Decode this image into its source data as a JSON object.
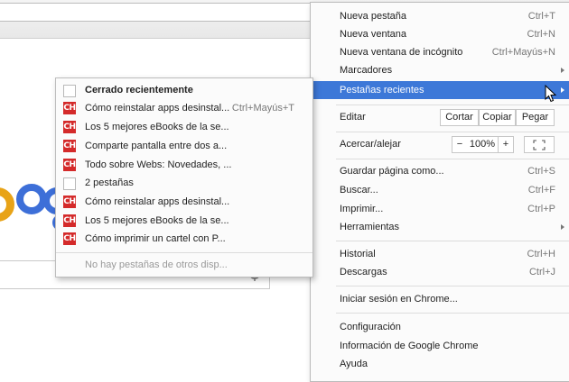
{
  "colors": {
    "highlight": "#3d78d8",
    "ch_icon": "#d42a2a"
  },
  "main_menu": {
    "nueva_pestana": {
      "label": "Nueva pestaña",
      "shortcut": "Ctrl+T"
    },
    "nueva_ventana": {
      "label": "Nueva ventana",
      "shortcut": "Ctrl+N"
    },
    "incognito": {
      "label": "Nueva ventana de incógnito",
      "shortcut": "Ctrl+Mayús+N"
    },
    "marcadores": {
      "label": "Marcadores"
    },
    "pestanas_recientes": {
      "label": "Pestañas recientes"
    },
    "editar": {
      "label": "Editar",
      "cortar": "Cortar",
      "copiar": "Copiar",
      "pegar": "Pegar"
    },
    "zoom": {
      "label": "Acercar/alejar",
      "minus": "−",
      "value": "100%",
      "plus": "+"
    },
    "guardar": {
      "label": "Guardar página como...",
      "shortcut": "Ctrl+S"
    },
    "buscar": {
      "label": "Buscar...",
      "shortcut": "Ctrl+F"
    },
    "imprimir": {
      "label": "Imprimir...",
      "shortcut": "Ctrl+P"
    },
    "herramientas": {
      "label": "Herramientas"
    },
    "historial": {
      "label": "Historial",
      "shortcut": "Ctrl+H"
    },
    "descargas": {
      "label": "Descargas",
      "shortcut": "Ctrl+J"
    },
    "iniciar_sesion": {
      "label": "Iniciar sesión en Chrome..."
    },
    "configuracion": {
      "label": "Configuración"
    },
    "informacion": {
      "label": "Información de Google Chrome"
    },
    "ayuda": {
      "label": "Ayuda"
    }
  },
  "sub_menu": {
    "header": "Cerrado recientemente",
    "items": [
      {
        "label": "Cómo reinstalar apps desinstal...",
        "shortcut": "Ctrl+Mayús+T",
        "icon": "ch"
      },
      {
        "label": "Los 5 mejores eBooks de la se...",
        "icon": "ch"
      },
      {
        "label": "Comparte pantalla entre dos a...",
        "icon": "ch"
      },
      {
        "label": "Todo sobre Webs: Novedades, ...",
        "icon": "ch"
      },
      {
        "label": "2 pestañas",
        "icon": "page"
      },
      {
        "label": "Cómo reinstalar apps desinstal...",
        "icon": "ch"
      },
      {
        "label": "Los 5 mejores eBooks de la se...",
        "icon": "ch"
      },
      {
        "label": "Cómo imprimir un cartel con P...",
        "icon": "ch"
      }
    ],
    "ch_badge": "CH",
    "footer": "No hay pestañas de otros disp..."
  }
}
